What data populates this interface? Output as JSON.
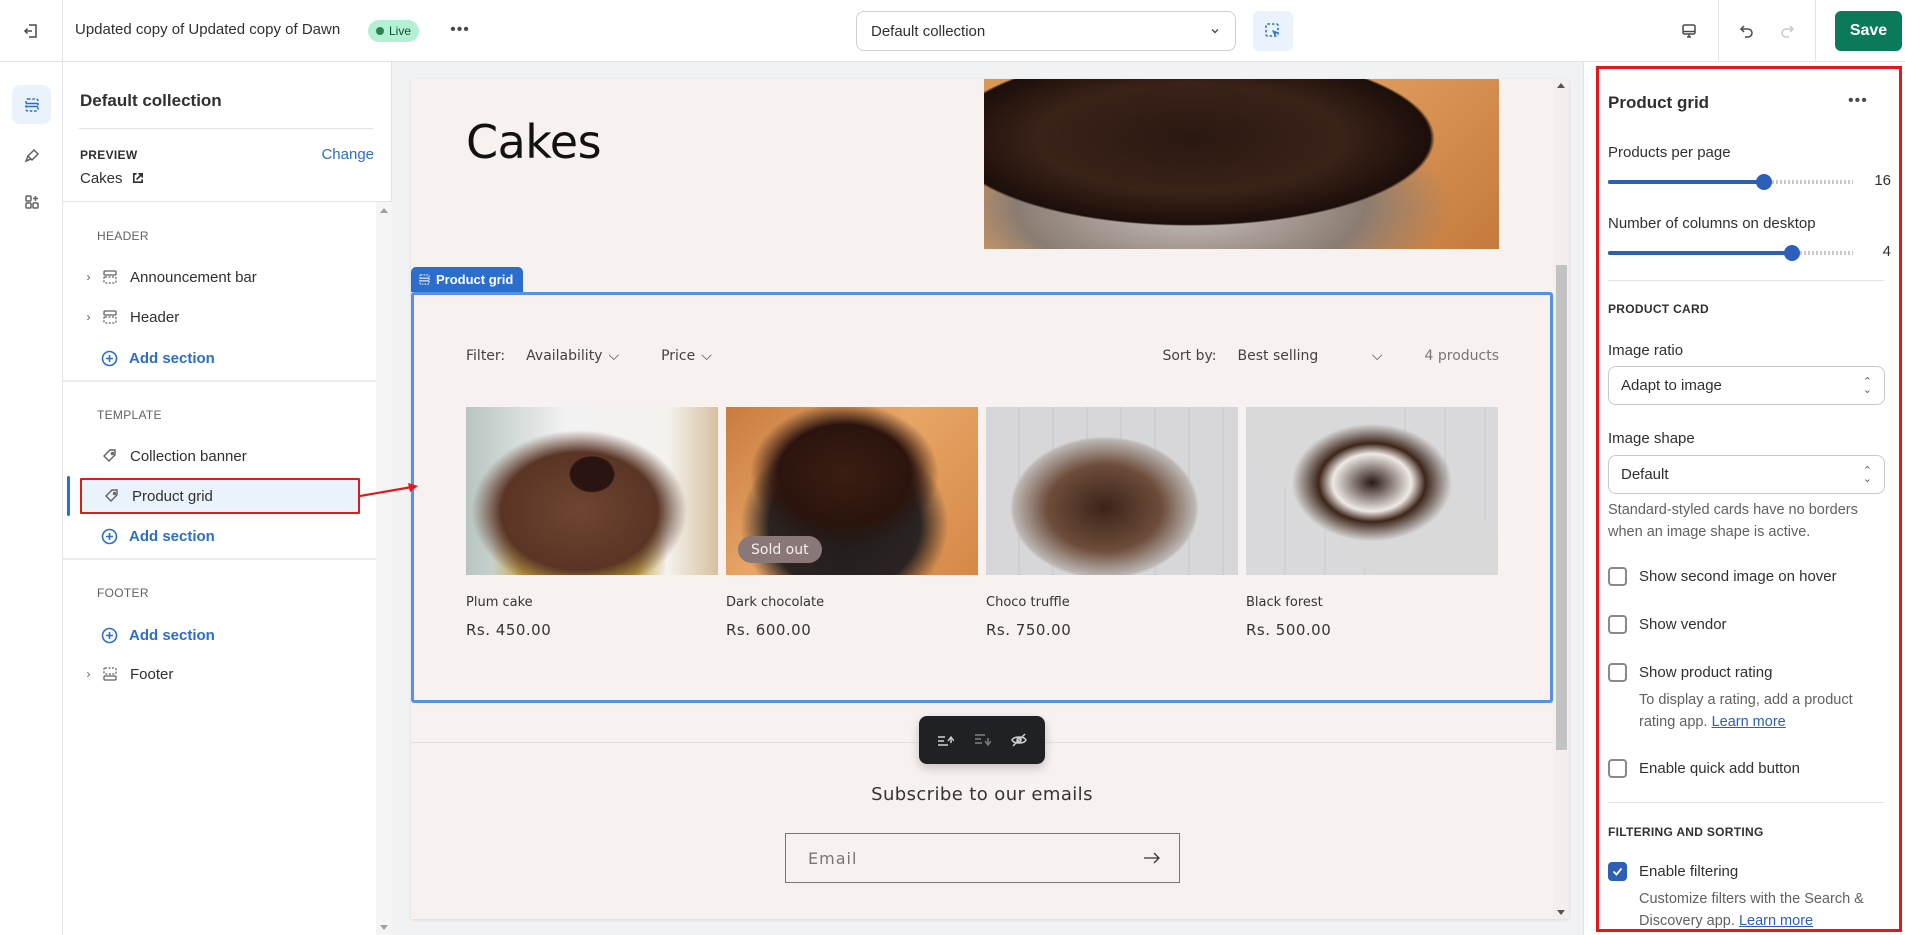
{
  "topbar": {
    "theme_name": "Updated copy of Updated copy of Dawn",
    "status_badge": "Live",
    "more_label": "•••",
    "template_select": "Default collection",
    "save_label": "Save"
  },
  "rail": {
    "items": [
      {
        "icon": "sections-icon",
        "active": true
      },
      {
        "icon": "theme-settings-brush-icon",
        "active": false
      },
      {
        "icon": "app-embeds-icon",
        "active": false
      }
    ]
  },
  "left_panel": {
    "title": "Default collection",
    "preview_label": "PREVIEW",
    "change_label": "Change",
    "preview_value": "Cakes",
    "groups": {
      "header": {
        "label": "HEADER",
        "items": [
          {
            "label": "Announcement bar",
            "icon": "section-header-icon"
          },
          {
            "label": "Header",
            "icon": "section-header-icon"
          }
        ],
        "add_label": "Add section"
      },
      "template": {
        "label": "TEMPLATE",
        "items": [
          {
            "label": "Collection banner",
            "icon": "tag-icon"
          },
          {
            "label": "Product grid",
            "icon": "tag-icon",
            "selected": true
          }
        ],
        "add_label": "Add section"
      },
      "footer": {
        "label": "FOOTER",
        "add_label": "Add section",
        "items": [
          {
            "label": "Footer",
            "icon": "section-footer-icon"
          }
        ]
      }
    }
  },
  "preview": {
    "banner_title": "Cakes",
    "section_tab": "Product grid",
    "filter_label": "Filter:",
    "filters": [
      "Availability",
      "Price"
    ],
    "sort_label": "Sort by:",
    "sort_value": "Best selling",
    "product_count": "4 products",
    "products": [
      {
        "name": "Plum cake",
        "price": "Rs. 450.00",
        "badge": null
      },
      {
        "name": "Dark chocolate",
        "price": "Rs. 600.00",
        "badge": "Sold out"
      },
      {
        "name": "Choco truffle",
        "price": "Rs. 750.00",
        "badge": null
      },
      {
        "name": "Black forest",
        "price": "Rs. 500.00",
        "badge": null
      }
    ],
    "subscribe_title": "Subscribe to our emails",
    "email_placeholder": "Email"
  },
  "right_panel": {
    "title": "Product grid",
    "products_per_page": {
      "label": "Products per page",
      "value": 16,
      "min": 2,
      "max": 24
    },
    "columns_desktop": {
      "label": "Number of columns on desktop",
      "value": 4,
      "min": 1,
      "max": 5
    },
    "product_card_heading": "PRODUCT CARD",
    "image_ratio": {
      "label": "Image ratio",
      "value": "Adapt to image"
    },
    "image_shape": {
      "label": "Image shape",
      "value": "Default",
      "help": "Standard-styled cards have no borders when an image shape is active."
    },
    "checkboxes": [
      {
        "label": "Show second image on hover",
        "checked": false
      },
      {
        "label": "Show vendor",
        "checked": false
      },
      {
        "label": "Show product rating",
        "checked": false,
        "help": "To display a rating, add a product rating app.",
        "link": "Learn more"
      },
      {
        "label": "Enable quick add button",
        "checked": false
      }
    ],
    "filtering_heading": "FILTERING AND SORTING",
    "enable_filtering": {
      "label": "Enable filtering",
      "checked": true,
      "help": "Customize filters with the Search & Discovery app.",
      "link": "Learn more"
    }
  },
  "colors": {
    "accent_blue": "#2c6ecb",
    "save_green": "#0b7a5b",
    "live_badge_bg": "#b4f0d4",
    "annotation_red": "#e01a1a"
  }
}
